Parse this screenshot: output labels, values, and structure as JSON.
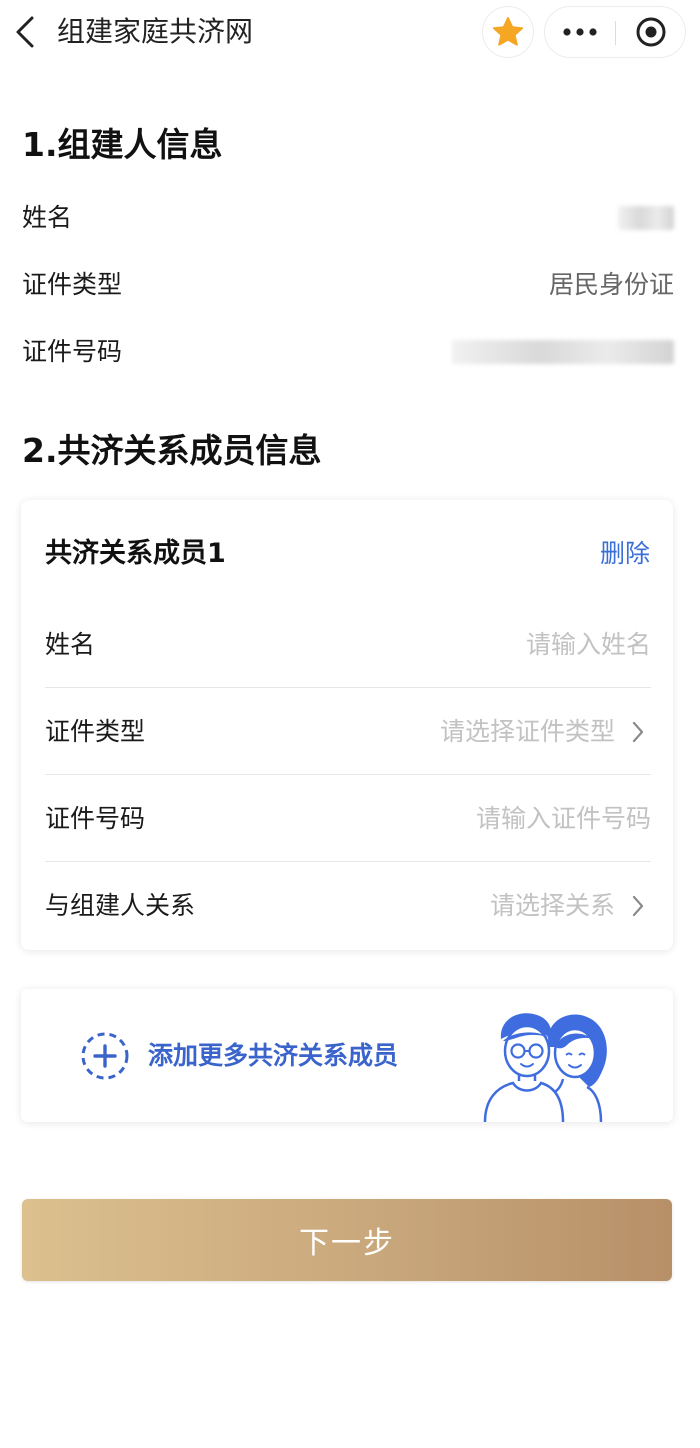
{
  "nav": {
    "title": "组建家庭共济网",
    "back_icon": "chevron-left-icon",
    "favorite_icon": "star-icon",
    "favorite_color": "#f5a623",
    "more_icon": "more-dots-icon",
    "close_icon": "target-circle-icon"
  },
  "section1": {
    "title": "1.组建人信息",
    "rows": [
      {
        "label": "姓名",
        "value": null,
        "redacted": true
      },
      {
        "label": "证件类型",
        "value": "居民身份证",
        "redacted": false
      },
      {
        "label": "证件号码",
        "value": null,
        "redacted": true
      }
    ]
  },
  "section2": {
    "title": "2.共济关系成员信息",
    "member": {
      "title": "共济关系成员1",
      "delete_label": "删除",
      "fields": [
        {
          "label": "姓名",
          "placeholder": "请输入姓名",
          "has_arrow": false
        },
        {
          "label": "证件类型",
          "placeholder": "请选择证件类型",
          "has_arrow": true
        },
        {
          "label": "证件号码",
          "placeholder": "请输入证件号码",
          "has_arrow": false
        },
        {
          "label": "与组建人关系",
          "placeholder": "请选择关系",
          "has_arrow": true
        }
      ]
    },
    "add_more": {
      "label": "添加更多共济关系成员",
      "icon": "add-circle-dashed-icon",
      "illustration": "couple-illustration"
    }
  },
  "next_button": {
    "label": "下一步"
  },
  "colors": {
    "accent_blue": "#3a64cc",
    "link_blue": "#3a6fd8",
    "button_gold_start": "#dcc08e",
    "button_gold_end": "#b79068",
    "placeholder": "#c2c2c2"
  }
}
